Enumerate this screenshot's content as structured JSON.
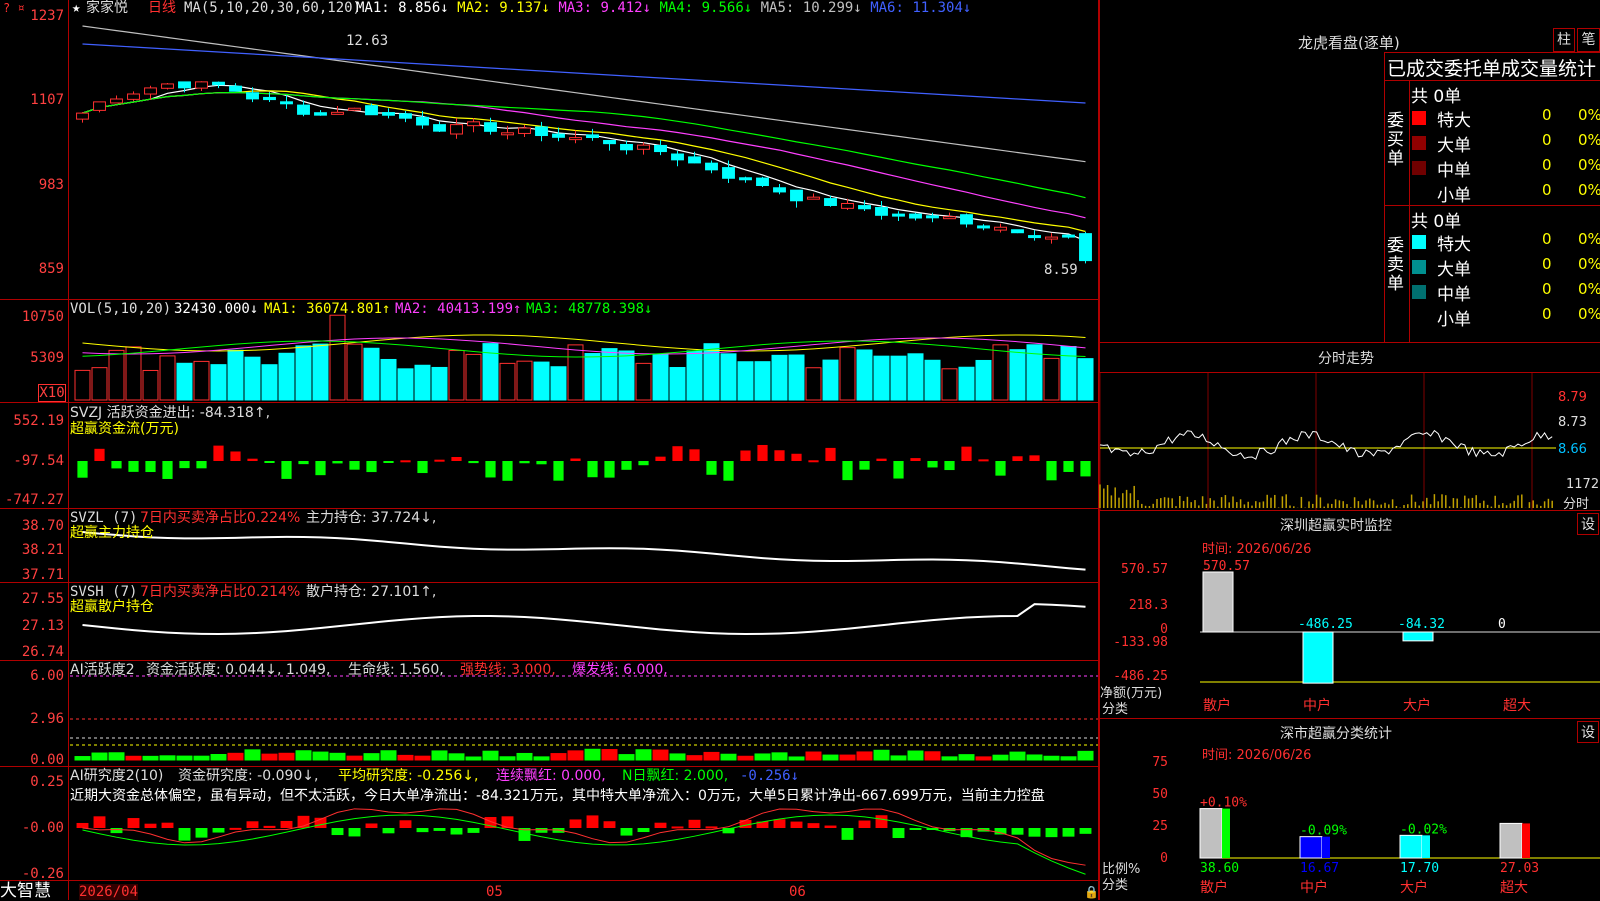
{
  "header": {
    "star": "★",
    "title": "家家悦",
    "period": "日线",
    "ma_label": "MA(5,10,20,30,60,120)",
    "ma_values": [
      {
        "text": "MA1: 8.856↓",
        "color": "#ffffff"
      },
      {
        "text": "MA2: 9.137↓",
        "color": "#ffff00"
      },
      {
        "text": "MA3: 9.412↓",
        "color": "#ff40ff"
      },
      {
        "text": "MA4: 9.566↓",
        "color": "#00ff00"
      },
      {
        "text": "MA5: 10.299↓",
        "color": "#c0c0c0"
      },
      {
        "text": "MA6: 11.304↓",
        "color": "#4060ff"
      }
    ],
    "high_mark": "12.63",
    "low_mark": "8.59",
    "left_marks": "?  ¤"
  },
  "price_axis": [
    "1237",
    "1107",
    "983",
    "859"
  ],
  "vol": {
    "label": "VOL(5,10,20)",
    "value": "32430.000↓",
    "ma1": "MA1: 36074.801↑",
    "ma2": "MA2: 40413.199↑",
    "ma3": "MA3: 48778.398↓",
    "axis": [
      "10750",
      "5309"
    ],
    "unit": "X10"
  },
  "svzj": {
    "label": "SVZJ  活跃资金进出: -84.318↑,",
    "sub": "超赢资金流(万元)",
    "axis": [
      "552.19",
      "-97.54",
      "-747.27"
    ]
  },
  "svzl": {
    "label_a": "SVZL (7)",
    "label_b": "7日内买卖净占比0.224%",
    "label_c": "主力持仓: 37.724↓,",
    "sub": "超赢主力持仓",
    "axis": [
      "38.70",
      "38.21",
      "37.71"
    ]
  },
  "svsh": {
    "label_a": "SVSH (7)",
    "label_b": "7日内买卖净占比0.214%",
    "label_c": "散户持仓: 27.101↑,",
    "sub": "超赢散户持仓",
    "axis": [
      "27.55",
      "27.13",
      "26.74"
    ]
  },
  "ai1": {
    "label_a": "AI活跃度2",
    "label_b": "资金活跃度: 0.044↓, 1.049,",
    "label_c": "生命线: 1.560,",
    "label_d": "强势线: 3.000,",
    "label_e": "爆发线: 6.000,",
    "axis": [
      "6.00",
      "2.96",
      "0.00"
    ]
  },
  "ai2": {
    "label_a": "AI研究度2(10)",
    "label_b": "资金研究度: -0.090↓,",
    "label_c": "平均研究度: -0.256↓,",
    "label_d": "连续飘红: 0.000,",
    "label_e": "N日飘红: 2.000,",
    "label_f": "-0.256↓",
    "comment": "近期大资金总体偏空，虽有异动，但不太活跃，今日大单净流出：-84.321万元，其中特大单净流入：0万元，大单5日累计净出-667.699万元，当前主力控盘",
    "axis": [
      "0.25",
      "-0.00",
      "-0.26"
    ]
  },
  "dates": {
    "d1": "2026/04",
    "d2": "05",
    "d3": "06"
  },
  "brand": "大智慧",
  "right": {
    "lhb_title": "龙虎看盘(逐单)",
    "btn_zhu": "柱",
    "btn_bi": "笔",
    "tabs": "已成交委托单成交量统计",
    "buy_total": "共 0单",
    "buy_side": "委买单",
    "sell_total": "共 0单",
    "sell_side": "委卖单",
    "buy_rows": [
      {
        "name": "特大",
        "v": "0",
        "p": "0%",
        "color": "#ff0000"
      },
      {
        "name": "大单",
        "v": "0",
        "p": "0%",
        "color": "#900000"
      },
      {
        "name": "中单",
        "v": "0",
        "p": "0%",
        "color": "#700000"
      },
      {
        "name": "小单",
        "v": "0",
        "p": "0%",
        "color": ""
      }
    ],
    "sell_rows": [
      {
        "name": "特大",
        "v": "0",
        "p": "0%",
        "color": "#00ffff"
      },
      {
        "name": "大单",
        "v": "0",
        "p": "0%",
        "color": "#009090"
      },
      {
        "name": "中单",
        "v": "0",
        "p": "0%",
        "color": "#007070"
      },
      {
        "name": "小单",
        "v": "0",
        "p": "0%",
        "color": ""
      }
    ],
    "intraday_title": "分时走势",
    "intraday_axis": [
      "8.79",
      "8.73",
      "8.66",
      "1172"
    ],
    "intraday_unit": "分时",
    "monitor_title": "深圳超赢实时监控",
    "monitor_btn": "设",
    "monitor_time": "时间: 2026/06/26",
    "monitor_axis": [
      "570.57",
      "218.3",
      "0",
      "-133.98",
      "-486.25"
    ],
    "monitor_ylabel": "净额(万元)",
    "monitor_xlabel": "分类",
    "monitor_cats": [
      "散户",
      "中户",
      "大户",
      "超大"
    ],
    "monitor_vals": [
      "570.57",
      "-486.25",
      "-84.32",
      "0"
    ],
    "stats_title": "深市超赢分类统计",
    "stats_btn": "设",
    "stats_time": "时间: 2026/06/26",
    "stats_axis": [
      "75",
      "50",
      "25",
      "0"
    ],
    "stats_ylabel": "比例%",
    "stats_xlabel": "分类",
    "stats_cats": [
      "散户",
      "中户",
      "大户",
      "超大"
    ],
    "stats_top": [
      "+0.10%",
      "-0.09%",
      "-0.02%",
      ""
    ],
    "stats_vals": [
      "38.60",
      "16.67",
      "17.70",
      "27.03"
    ]
  },
  "chart_data": [
    {
      "type": "candlestick",
      "title": "家家悦 日线",
      "ylim": [
        8.59,
        12.63
      ],
      "n_bars": 60,
      "close_start": 10.8,
      "close_end": 8.59,
      "max": 12.63,
      "min": 8.59,
      "ma_last": {
        "MA1": 8.856,
        "MA2": 9.137,
        "MA3": 9.412,
        "MA4": 9.566,
        "MA5": 10.299,
        "MA6": 11.304
      }
    },
    {
      "type": "bar",
      "title": "VOL(5,10,20)",
      "last": 32430.0,
      "ma": {
        "MA1": 36074.801,
        "MA2": 40413.199,
        "MA3": 48778.398
      }
    },
    {
      "type": "bar",
      "title": "SVZJ",
      "last": -84.318,
      "ylim": [
        -747.27,
        552.19
      ]
    },
    {
      "type": "line",
      "title": "SVZL (7)",
      "last": 37.724,
      "ylim": [
        37.71,
        38.7
      ]
    },
    {
      "type": "line",
      "title": "SVSH (7)",
      "last": 27.101,
      "ylim": [
        26.74,
        27.55
      ]
    },
    {
      "type": "bar",
      "title": "AI活跃度2",
      "last": 0.044,
      "lines": {
        "生命线": 1.56,
        "强势线": 3.0,
        "爆发线": 6.0
      },
      "ylim": [
        0,
        6.0
      ]
    },
    {
      "type": "bar",
      "title": "AI研究度2(10)",
      "last": -0.09,
      "avg": -0.256,
      "ylim": [
        -0.26,
        0.25
      ]
    },
    {
      "type": "bar",
      "title": "深圳超赢实时监控",
      "categories": [
        "散户",
        "中户",
        "大户",
        "超大"
      ],
      "values": [
        570.57,
        -486.25,
        -84.32,
        0
      ],
      "ylim": [
        -486.25,
        570.57
      ]
    },
    {
      "type": "bar",
      "title": "深市超赢分类统计",
      "categories": [
        "散户",
        "中户",
        "大户",
        "超大"
      ],
      "values": [
        38.6,
        16.67,
        17.7,
        27.03
      ],
      "ylim": [
        0,
        75
      ]
    }
  ]
}
